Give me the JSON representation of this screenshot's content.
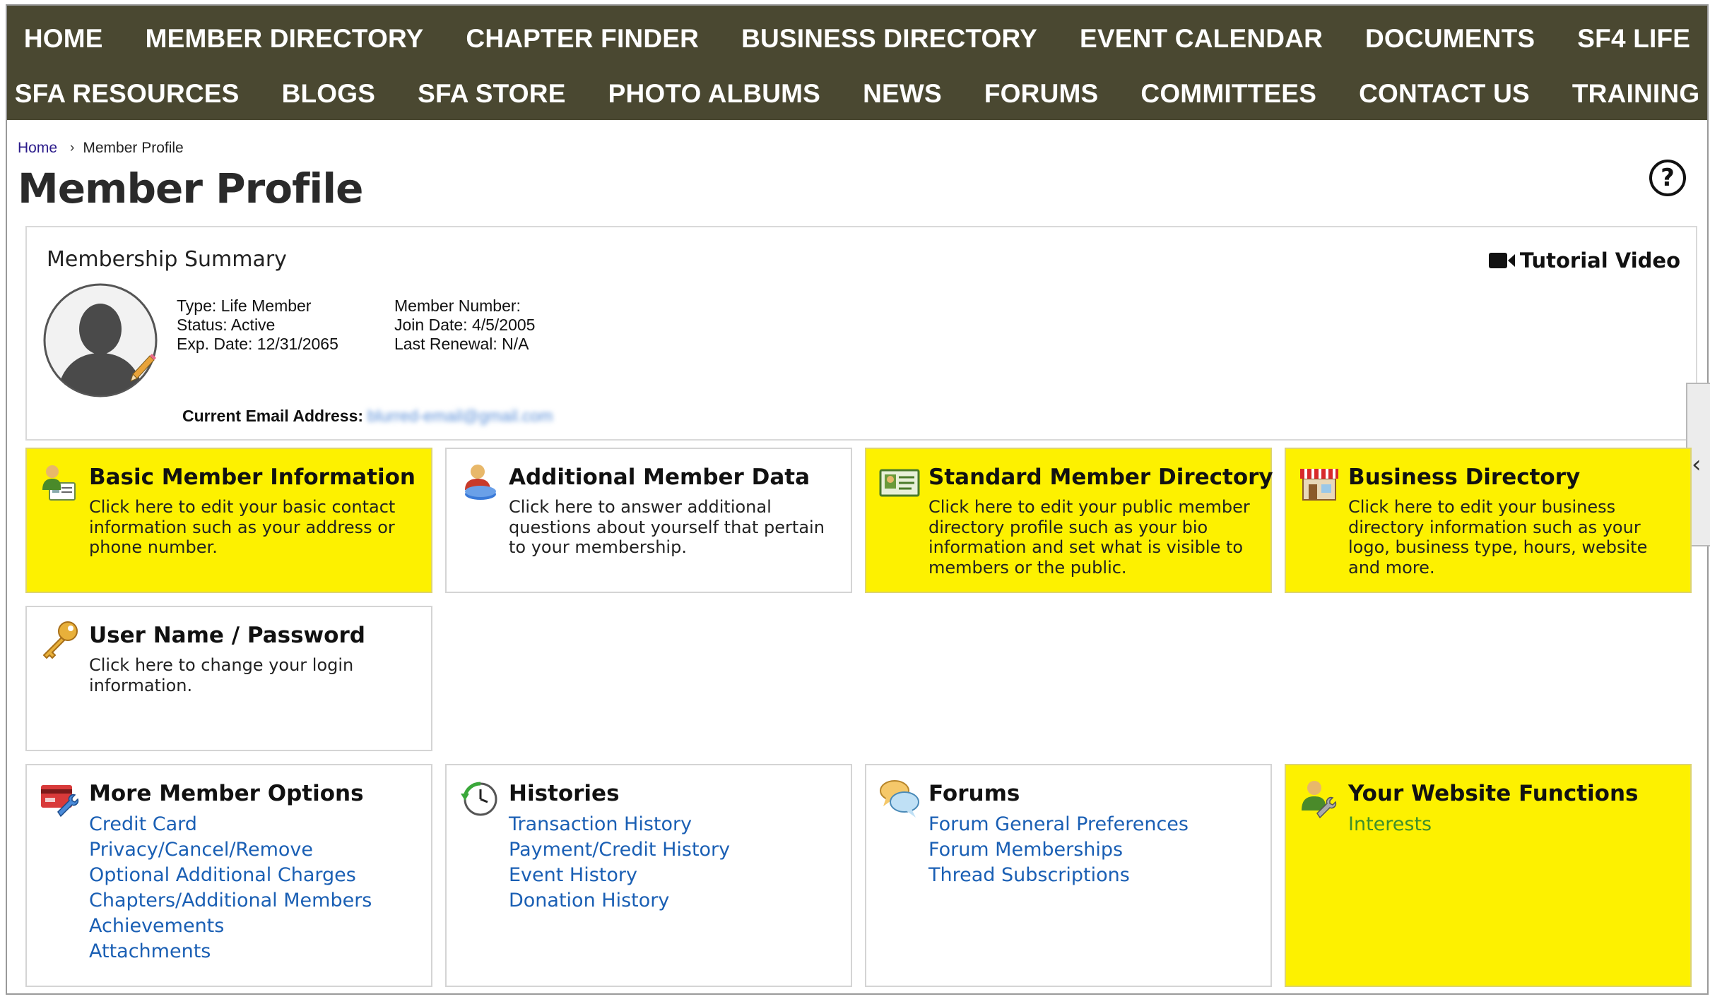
{
  "nav": {
    "row1": [
      "HOME",
      "MEMBER DIRECTORY",
      "CHAPTER FINDER",
      "BUSINESS DIRECTORY",
      "EVENT CALENDAR",
      "DOCUMENTS",
      "SF4 LIFE"
    ],
    "row2": [
      "SFA RESOURCES",
      "BLOGS",
      "SFA STORE",
      "PHOTO ALBUMS",
      "NEWS",
      "FORUMS",
      "COMMITTEES",
      "CONTACT US",
      "TRAINING"
    ]
  },
  "breadcrumb": {
    "home": "Home",
    "separator": "›",
    "current": "Member Profile"
  },
  "page_title": "Member Profile",
  "help_icon": "?",
  "summary": {
    "heading": "Membership Summary",
    "tutorial_label": "Tutorial Video",
    "col1": [
      "Type: Life Member",
      "Status: Active",
      "Exp. Date: 12/31/2065"
    ],
    "col2": [
      "Member Number:",
      "Join Date: 4/5/2005",
      "Last Renewal: N/A"
    ],
    "email_label": "Current Email Address:",
    "email_value": "blurred-email@gmail.com"
  },
  "side_handle": "‹",
  "cards": {
    "basic": {
      "title": "Basic Member Information",
      "desc": "Click here to edit your basic contact information such as your address or phone number.",
      "icon": "member-card-icon"
    },
    "additional": {
      "title": "Additional Member Data",
      "desc": "Click here to answer additional questions about yourself that pertain to your membership.",
      "icon": "member-data-icon"
    },
    "standard_dir": {
      "title": "Standard Member Directory",
      "desc": "Click here to edit your public member directory profile such as your bio information and set what is visible to members or the public.",
      "icon": "id-card-icon"
    },
    "business_dir": {
      "title": "Business Directory",
      "desc": "Click here to edit your business directory information such as your logo, business type, hours, website and more.",
      "icon": "storefront-icon"
    },
    "username": {
      "title": "User Name / Password",
      "desc": "Click here to change your login information.",
      "icon": "key-icon"
    },
    "more_options": {
      "title": "More Member Options",
      "links": [
        "Credit Card",
        "Privacy/Cancel/Remove",
        "Optional Additional Charges",
        "Chapters/Additional Members",
        "Achievements",
        "Attachments"
      ],
      "icon": "card-wrench-icon"
    },
    "histories": {
      "title": "Histories",
      "links": [
        "Transaction History",
        "Payment/Credit History",
        "Event History",
        "Donation History"
      ],
      "icon": "clock-history-icon"
    },
    "forums": {
      "title": "Forums",
      "links": [
        "Forum General Preferences",
        "Forum Memberships",
        "Thread Subscriptions"
      ],
      "icon": "speech-bubbles-icon"
    },
    "website_functions": {
      "title": "Your Website Functions",
      "links": [
        "Interests"
      ],
      "icon": "member-wrench-icon"
    }
  },
  "colors": {
    "nav_bg": "#4a4831",
    "card_yellow": "#fdf100",
    "link_blue": "#1a5fb4",
    "link_green": "#3f8f2a"
  }
}
